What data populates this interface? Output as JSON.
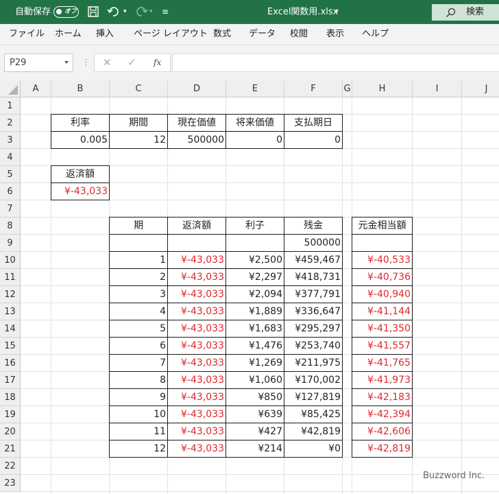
{
  "window": {
    "autosave_label": "自動保存",
    "autosave_state": "オフ",
    "file_title": "Excel関数用.xlsx",
    "search_label": "検索"
  },
  "ribbon": {
    "tabs": [
      "ファイル",
      "ホーム",
      "挿入",
      "ページ レイアウト",
      "数式",
      "データ",
      "校閲",
      "表示",
      "ヘルプ"
    ]
  },
  "formula_bar": {
    "name_box": "P29",
    "formula": ""
  },
  "sheet": {
    "columns": [
      "A",
      "B",
      "C",
      "D",
      "E",
      "F",
      "G",
      "H",
      "I",
      "J"
    ],
    "rows": [
      "1",
      "2",
      "3",
      "4",
      "5",
      "6",
      "7",
      "8",
      "9",
      "10",
      "11",
      "12",
      "13",
      "14",
      "15",
      "16",
      "17",
      "18",
      "19",
      "20",
      "21",
      "22",
      "23"
    ],
    "params_headers": [
      "利率",
      "期間",
      "現在価値",
      "将来価値",
      "支払期日"
    ],
    "params_values": [
      "0.005",
      "12",
      "500000",
      "0",
      "0"
    ],
    "payment_header": "返済額",
    "payment_value": "¥-43,033",
    "schedule_headers": [
      "期",
      "返済額",
      "利子",
      "残金"
    ],
    "principal_header": "元金相当額",
    "initial_balance": "500000",
    "schedule": [
      {
        "period": "1",
        "payment": "¥-43,033",
        "interest": "¥2,500",
        "balance": "¥459,467",
        "principal": "¥-40,533"
      },
      {
        "period": "2",
        "payment": "¥-43,033",
        "interest": "¥2,297",
        "balance": "¥418,731",
        "principal": "¥-40,736"
      },
      {
        "period": "3",
        "payment": "¥-43,033",
        "interest": "¥2,094",
        "balance": "¥377,791",
        "principal": "¥-40,940"
      },
      {
        "period": "4",
        "payment": "¥-43,033",
        "interest": "¥1,889",
        "balance": "¥336,647",
        "principal": "¥-41,144"
      },
      {
        "period": "5",
        "payment": "¥-43,033",
        "interest": "¥1,683",
        "balance": "¥295,297",
        "principal": "¥-41,350"
      },
      {
        "period": "6",
        "payment": "¥-43,033",
        "interest": "¥1,476",
        "balance": "¥253,740",
        "principal": "¥-41,557"
      },
      {
        "period": "7",
        "payment": "¥-43,033",
        "interest": "¥1,269",
        "balance": "¥211,975",
        "principal": "¥-41,765"
      },
      {
        "period": "8",
        "payment": "¥-43,033",
        "interest": "¥1,060",
        "balance": "¥170,002",
        "principal": "¥-41,973"
      },
      {
        "period": "9",
        "payment": "¥-43,033",
        "interest": "¥850",
        "balance": "¥127,819",
        "principal": "¥-42,183"
      },
      {
        "period": "10",
        "payment": "¥-43,033",
        "interest": "¥639",
        "balance": "¥85,425",
        "principal": "¥-42,394"
      },
      {
        "period": "11",
        "payment": "¥-43,033",
        "interest": "¥427",
        "balance": "¥42,819",
        "principal": "¥-42,606"
      },
      {
        "period": "12",
        "payment": "¥-43,033",
        "interest": "¥214",
        "balance": "¥0",
        "principal": "¥-42,819"
      }
    ]
  },
  "watermark": "Buzzword Inc.",
  "colors": {
    "title_bar": "#217346",
    "negative_text": "#e0262b",
    "header_bg": "#efefef"
  }
}
